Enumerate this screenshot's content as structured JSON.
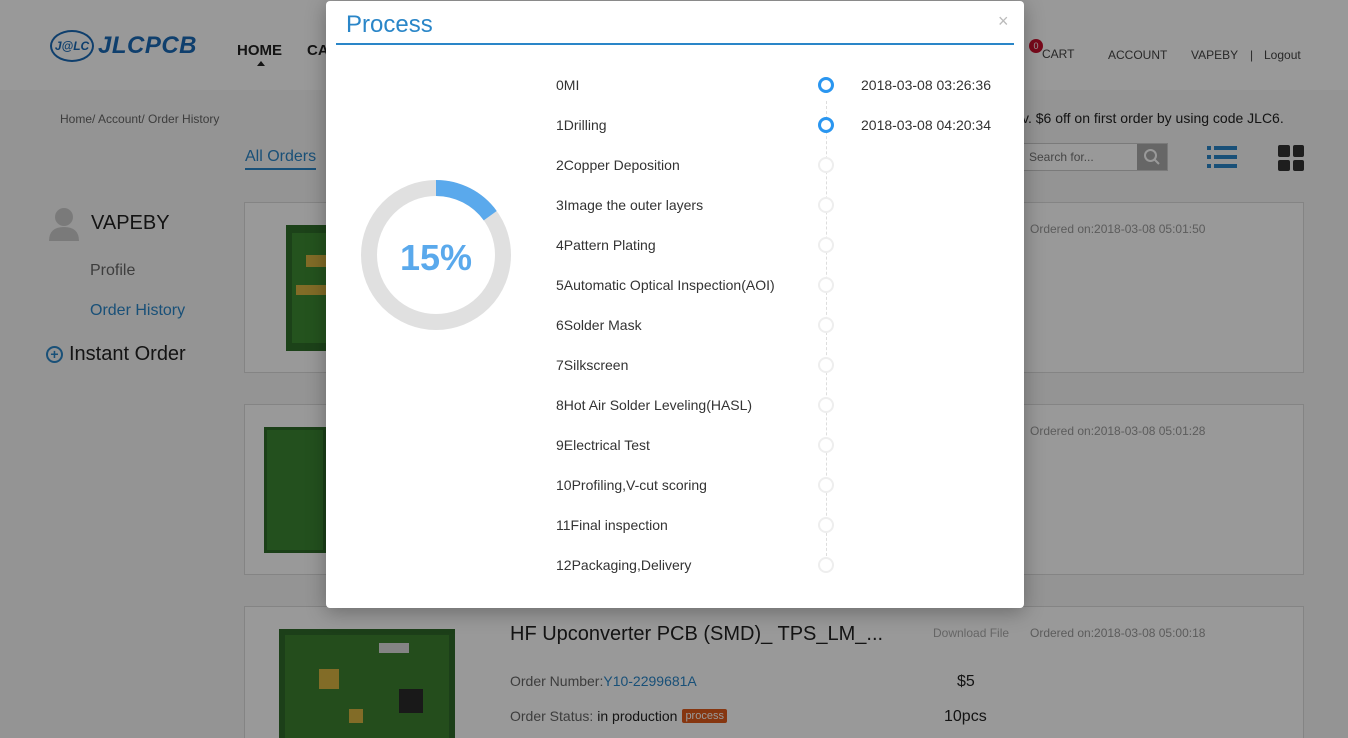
{
  "header": {
    "logo_badge": "J@LC",
    "logo_text": "JLCPCB",
    "nav_home": "HOME",
    "nav_partial": "CA",
    "cart_count": "0",
    "cart_label": "CART",
    "account": "ACCOUNT",
    "user": "VAPEBY",
    "separator": "|",
    "logout": "Logout"
  },
  "breadcrumb": "Home/ Account/ Order History",
  "promo": "v. $6 off on first order by using code JLC6.",
  "orders_toolbar": {
    "tab_all": "All Orders",
    "search_placeholder": "Search for..."
  },
  "sidebar": {
    "username": "VAPEBY",
    "profile": "Profile",
    "order_history": "Order History",
    "instant_order": "Instant Order"
  },
  "orders": [
    {
      "ordered_on": "Ordered on:2018-03-08 05:01:50"
    },
    {
      "ordered_on": "Ordered on:2018-03-08 05:01:28"
    },
    {
      "title": "HF Upconverter PCB (SMD)_ TPS_LM_...",
      "download": "Download File",
      "ordered_on": "Ordered on:2018-03-08 05:00:18",
      "number_label": "Order Number:",
      "number_value": "Y10-2299681A",
      "status_label": "Order Status:",
      "status_value": "in production",
      "status_tag": "process",
      "price": "$5",
      "qty": "10pcs"
    }
  ],
  "modal": {
    "title": "Process",
    "close": "×",
    "progress_text": "15%",
    "progress_fraction": 0.15,
    "accent_color": "#2a86c8",
    "progress_color": "#5aa9ec",
    "steps": [
      {
        "label": "0MI",
        "time": "2018-03-08 03:26:36",
        "done": true
      },
      {
        "label": "1Drilling",
        "time": "2018-03-08 04:20:34",
        "done": true
      },
      {
        "label": "2Copper Deposition",
        "time": "",
        "done": false
      },
      {
        "label": "3Image the outer layers",
        "time": "",
        "done": false
      },
      {
        "label": "4Pattern Plating",
        "time": "",
        "done": false
      },
      {
        "label": "5Automatic Optical Inspection(AOI)",
        "time": "",
        "done": false
      },
      {
        "label": "6Solder Mask",
        "time": "",
        "done": false
      },
      {
        "label": "7Silkscreen",
        "time": "",
        "done": false
      },
      {
        "label": "8Hot Air Solder Leveling(HASL)",
        "time": "",
        "done": false
      },
      {
        "label": "9Electrical Test",
        "time": "",
        "done": false
      },
      {
        "label": "10Profiling,V-cut scoring",
        "time": "",
        "done": false
      },
      {
        "label": "11Final inspection",
        "time": "",
        "done": false
      },
      {
        "label": "12Packaging,Delivery",
        "time": "",
        "done": false
      }
    ]
  }
}
